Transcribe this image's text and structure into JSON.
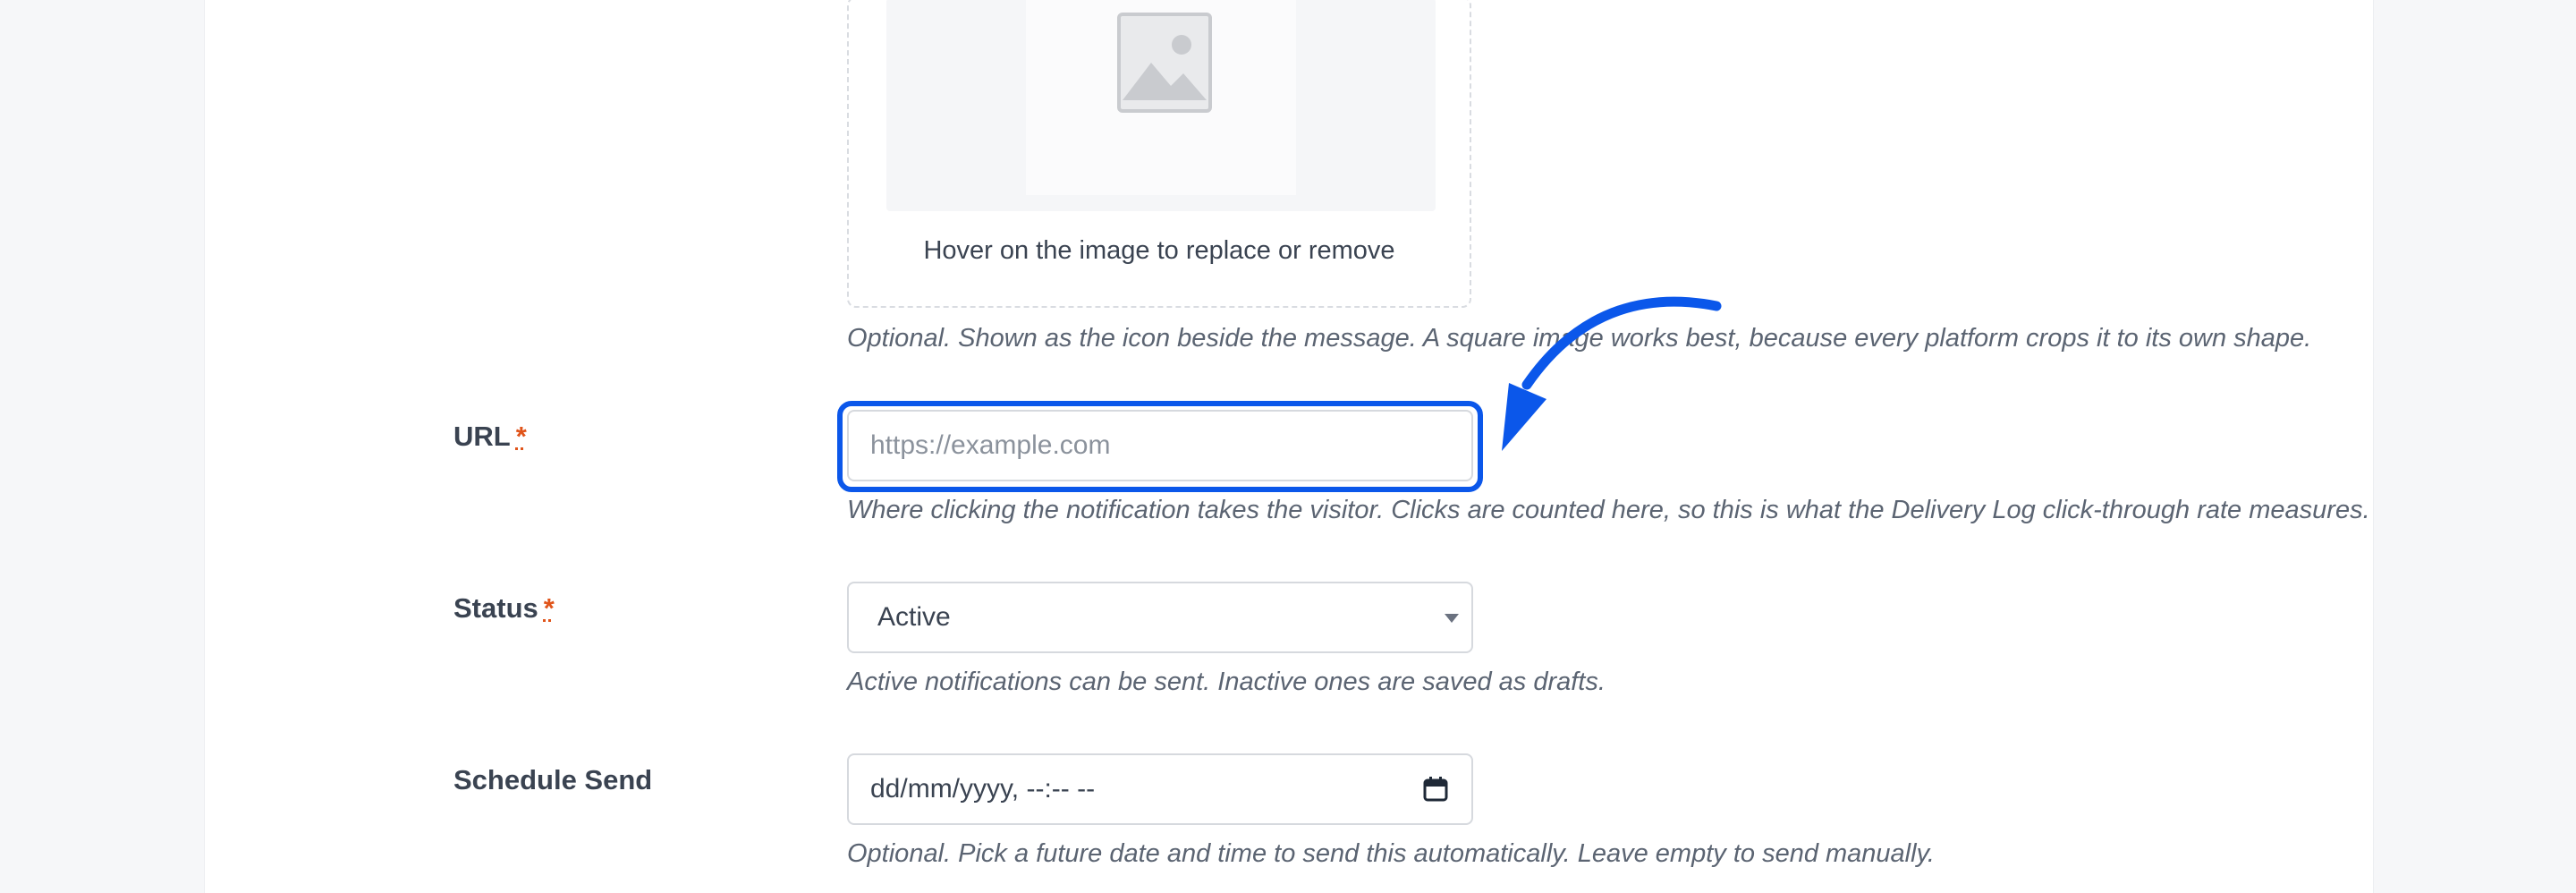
{
  "image_field": {
    "hover_hint": "Hover on the image to replace or remove",
    "help": "Optional. Shown as the icon beside the message. A square image works best, because every platform crops it to its own shape."
  },
  "url_field": {
    "label": "URL",
    "required_mark": "*",
    "placeholder": "https://example.com",
    "value": "",
    "help": "Where clicking the notification takes the visitor. Clicks are counted here, so this is what the Delivery Log click-through rate measures."
  },
  "status_field": {
    "label": "Status",
    "required_mark": "*",
    "selected": "Active",
    "help": "Active notifications can be sent. Inactive ones are saved as drafts."
  },
  "schedule_field": {
    "label": "Schedule Send",
    "placeholder": "dd/mm/yyyy, --:-- --",
    "help": "Optional. Pick a future date and time to send this automatically. Leave empty to send manually."
  },
  "colors": {
    "highlight": "#0b57ea",
    "required": "#e0541a"
  },
  "icons": [
    "image-placeholder-icon",
    "chevron-down-icon",
    "calendar-icon",
    "annotation-arrow-icon"
  ]
}
